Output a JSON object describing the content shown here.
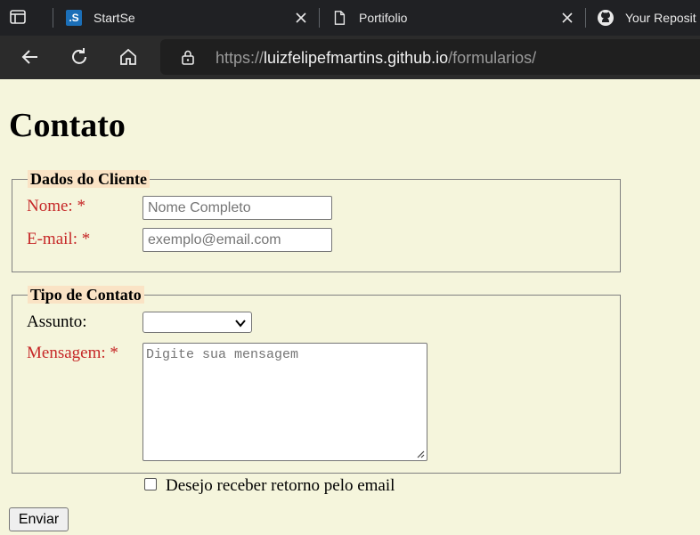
{
  "browser": {
    "tabs": [
      {
        "title": "StartSe",
        "favicon": "startse-logo-icon"
      },
      {
        "title": "Portifolio",
        "favicon": "page-icon"
      },
      {
        "title": "Your Reposit",
        "favicon": "github-icon"
      }
    ],
    "url": {
      "scheme": "https://",
      "host": "luizfelipefmartins.github.io",
      "path": "/formularios/"
    }
  },
  "page": {
    "heading": "Contato",
    "client_section": {
      "legend": "Dados do Cliente",
      "name_label": "Nome:",
      "name_required": "*",
      "name_placeholder": "Nome Completo",
      "email_label": "E-mail:",
      "email_required": "*",
      "email_placeholder": "exemplo@email.com"
    },
    "contact_section": {
      "legend": "Tipo de Contato",
      "subject_label": "Assunto:",
      "subject_value": "",
      "message_label": "Mensagem:",
      "message_required": "*",
      "message_placeholder": "Digite sua mensagem"
    },
    "checkbox_label": "Desejo receber retorno pelo email",
    "submit_label": "Enviar"
  },
  "colors": {
    "page_background": "#f5f5dc",
    "legend_background": "#fae3c5",
    "required_label": "#c62828"
  }
}
